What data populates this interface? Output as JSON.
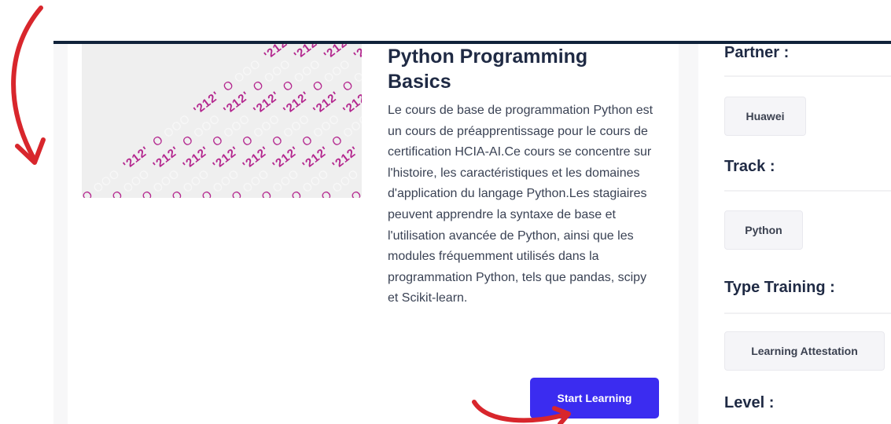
{
  "course": {
    "title": "Python Programming Basics",
    "description": "Le cours de base de programmation Python est un cours de préapprentissage pour le cours de certification HCIA-AI.Ce cours se concentre sur l'histoire, les caractéristiques et les domaines d'application du langage Python.Les stagiaires peuvent apprendre la syntaxe de base et l'utilisation avancée de Python, ainsi que les modules fréquemment utilisés dans la programmation Python, tels que pandas, scipy et Scikit-learn.",
    "start_button": "Start Learning",
    "thumbnail_text": "'212'"
  },
  "details": {
    "partner_label": "Partner :",
    "partner_value": "Huawei",
    "track_label": "Track :",
    "track_value": "Python",
    "type_label": "Type Training :",
    "type_value": "Learning Attestation",
    "level_label": "Level :"
  },
  "colors": {
    "accent": "#3b2cf0",
    "annotation_arrow": "#d8262c",
    "header_bar": "#10223a",
    "pattern": "#b4288f"
  }
}
